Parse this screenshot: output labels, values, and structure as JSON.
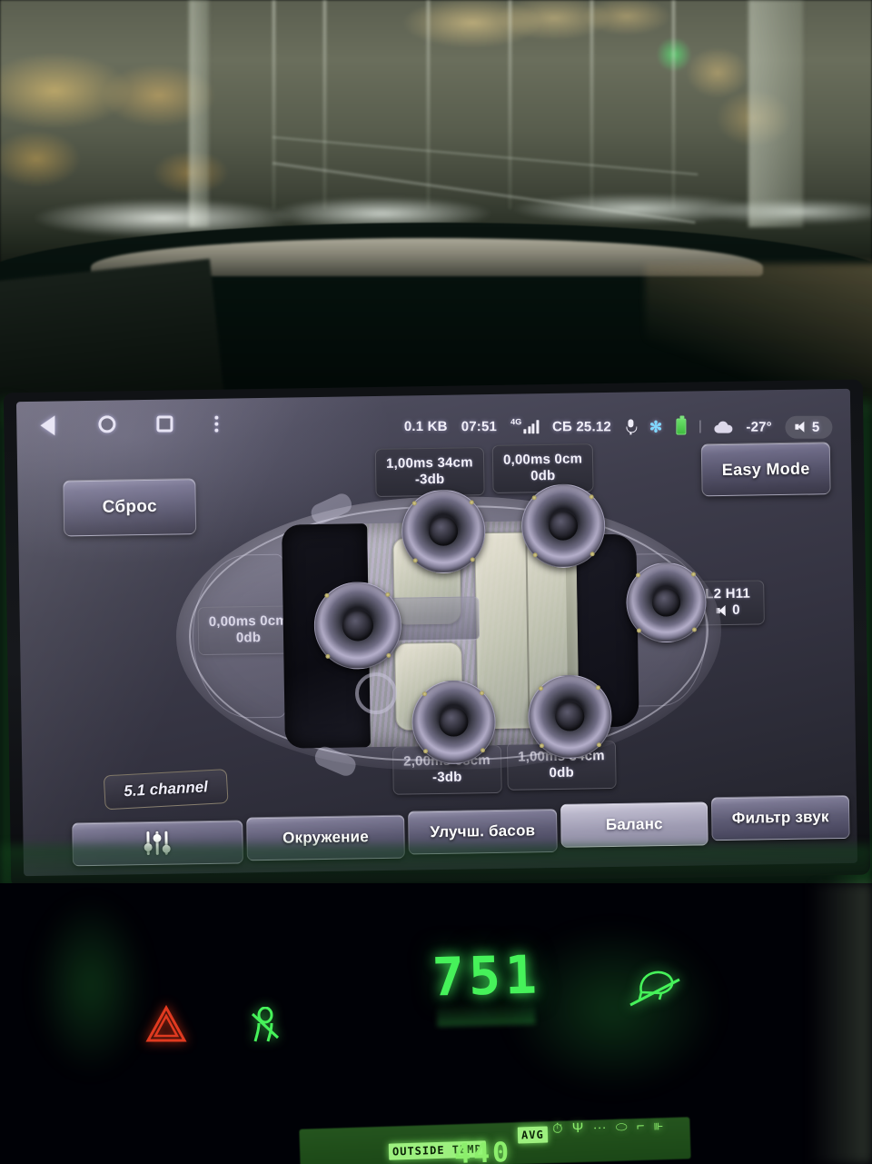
{
  "status_bar": {
    "data_usage": "0.1 KB",
    "time": "07:51",
    "network_type": "4G",
    "date": "СБ 25.12",
    "temperature": "-27°",
    "volume_level": "5",
    "icons": {
      "mic": "microphone-icon",
      "bluetooth": "bluetooth-icon",
      "battery": "battery-icon",
      "weather": "cloud-icon",
      "signal": "signal-bars-icon",
      "volume": "speaker-icon"
    }
  },
  "nav_bar": {
    "back": "back-triangle-icon",
    "home": "home-circle-icon",
    "recents": "recents-square-icon",
    "overflow": "overflow-dots-icon"
  },
  "header": {
    "reset_label": "Сброс",
    "easy_mode_label": "Easy Mode"
  },
  "channel_badge": "5.1 channel",
  "speakers": {
    "front_left": {
      "delay_ms": "1,00ms",
      "distance": "34cm",
      "gain": "-3db"
    },
    "front_right": {
      "delay_ms": "0,00ms",
      "distance": "0cm",
      "gain": "0db"
    },
    "rear_left": {
      "delay_ms": "2,00ms",
      "distance": "68cm",
      "gain": "-3db"
    },
    "rear_right": {
      "delay_ms": "1,00ms",
      "distance": "34cm",
      "gain": "0db"
    },
    "side_left": {
      "delay_ms": "0,00ms",
      "distance": "0cm",
      "gain": "0db"
    },
    "side_right": {
      "low_pass": "L2",
      "high_pass": "H11",
      "gain": "0"
    }
  },
  "toolbar": {
    "equalizer_icon": "equalizer-sliders-icon",
    "environment_label": "Окружение",
    "bass_boost_label": "Улучш. басов",
    "balance_label": "Баланс",
    "sound_filter_label": "Фильтр звук",
    "active_tab": "Баланс"
  },
  "instrument_cluster": {
    "clock": "751",
    "outside_temp_label": "OUTSIDE TEMP",
    "avg_label": "AVG",
    "segment_digits": "440",
    "tiny_glyphs": "⏱ Ψ ⋯ ⬭ ⌐ ⊪",
    "indicators": [
      {
        "name": "hazard-warning-icon",
        "color": "#e03a20"
      },
      {
        "name": "traction-control-icon",
        "color": "#46f25a"
      },
      {
        "name": "incline-assist-icon",
        "color": "#46f25a"
      }
    ]
  },
  "colors": {
    "screen_bg": "#3e3d4c",
    "chip_bg": "#2f2f3a",
    "accent_text": "#f3f1fb",
    "vfd_green": "#46f25a",
    "hazard_red": "#e03a20"
  }
}
